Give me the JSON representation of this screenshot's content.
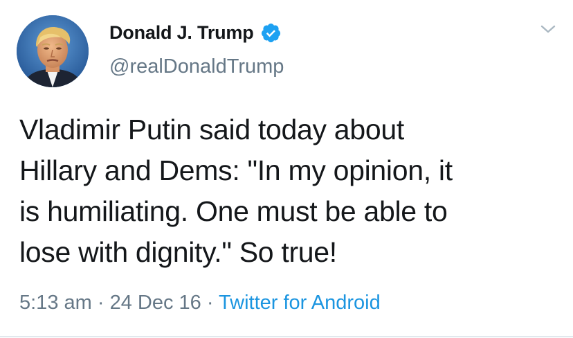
{
  "tweet": {
    "display_name": "Donald J. Trump",
    "handle": "@realDonaldTrump",
    "verified": true,
    "text": "Vladimir Putin said today about\nHillary and Dems: \"In my opinion, it\nis humiliating. One must be able to\nlose with dignity.\"  So true!",
    "time": "5:13 am",
    "separator": " · ",
    "date": "24 Dec 16",
    "source": "Twitter for Android"
  },
  "icons": {
    "verified": "verified-badge-icon",
    "menu": "chevron-down-icon",
    "avatar": "profile-photo"
  },
  "colors": {
    "text": "#14171a",
    "secondary": "#657786",
    "link": "#1b95e0",
    "verified_badge": "#1da1f2",
    "caret": "#aab8c2"
  }
}
